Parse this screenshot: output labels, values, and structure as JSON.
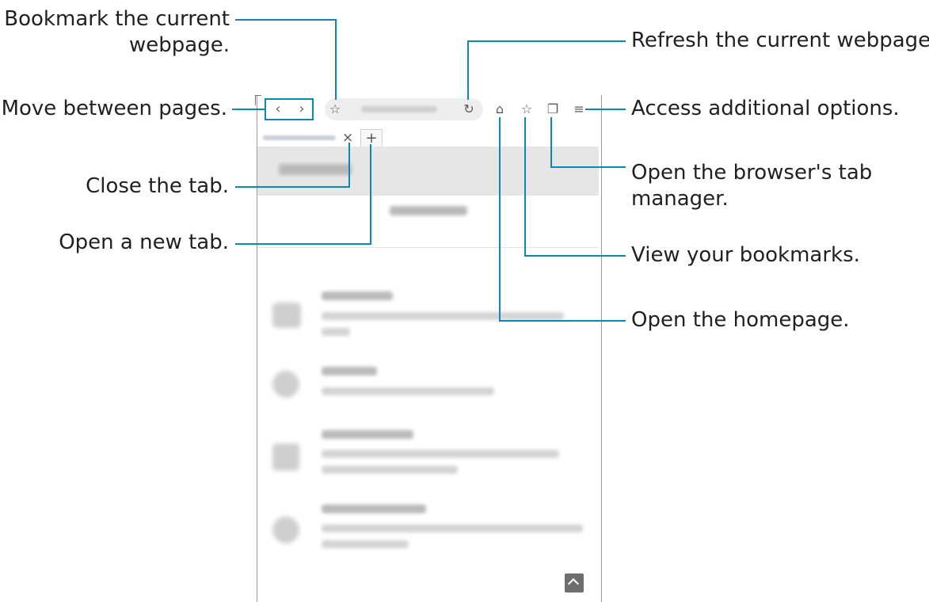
{
  "callouts": {
    "bookmark_current_line1": "Bookmark the current",
    "bookmark_current_line2": "webpage.",
    "move_between": "Move between pages.",
    "close_tab": "Close the tab.",
    "open_new_tab": "Open a new tab.",
    "refresh": "Refresh the current webpage.",
    "additional_options": "Access additional options.",
    "tab_manager_line1": "Open the browser's tab",
    "tab_manager_line2": "manager.",
    "view_bookmarks": "View your bookmarks.",
    "open_homepage": "Open the homepage."
  },
  "browser": {
    "icons": {
      "back": "‹",
      "forward": "›",
      "bookmark_star": "☆",
      "refresh": "↻",
      "home": "⌂",
      "bookmarks": "☆",
      "tabs": "❐",
      "menu": "≡",
      "close_tab": "×",
      "new_tab": "+"
    }
  },
  "colors": {
    "leader_line": "#0b87b8",
    "tab_underline": "#1a73d9"
  }
}
